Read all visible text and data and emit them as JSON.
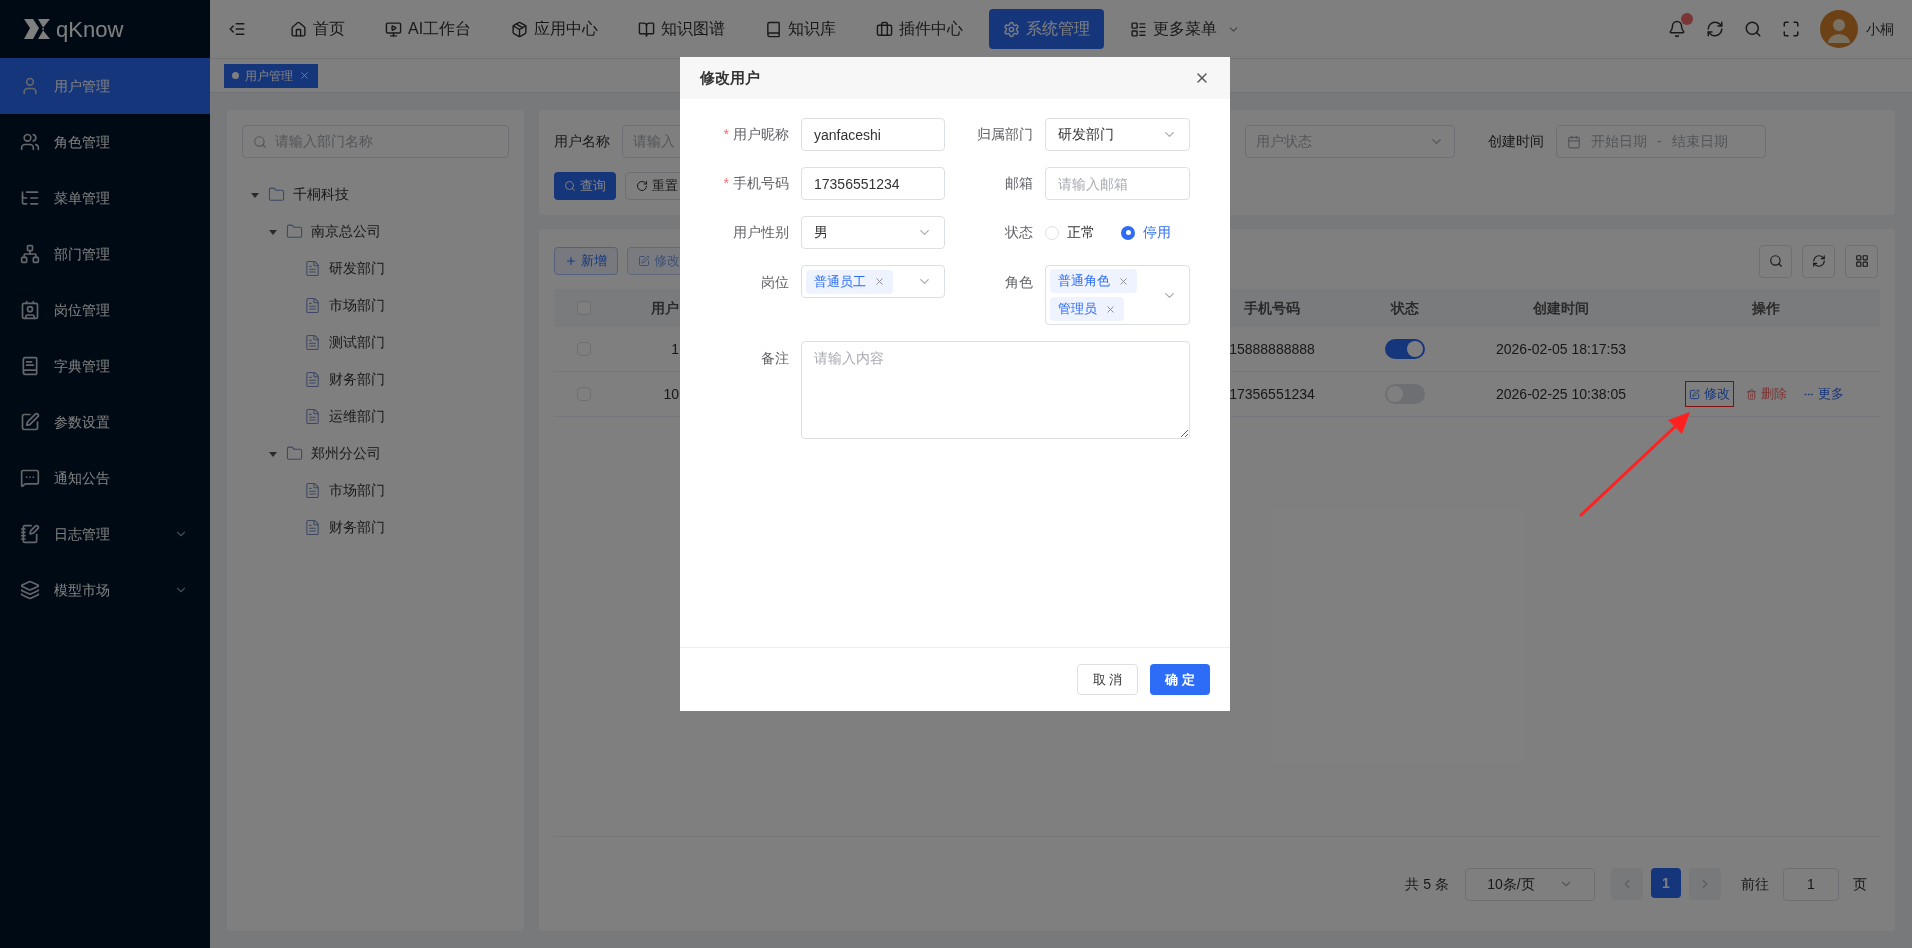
{
  "sidebar": {
    "logo": "qKnow",
    "items": [
      {
        "label": "用户管理",
        "selected": true,
        "submenu": false
      },
      {
        "label": "角色管理",
        "selected": false,
        "submenu": false
      },
      {
        "label": "菜单管理",
        "selected": false,
        "submenu": false
      },
      {
        "label": "部门管理",
        "selected": false,
        "submenu": false
      },
      {
        "label": "岗位管理",
        "selected": false,
        "submenu": false
      },
      {
        "label": "字典管理",
        "selected": false,
        "submenu": false
      },
      {
        "label": "参数设置",
        "selected": false,
        "submenu": false
      },
      {
        "label": "通知公告",
        "selected": false,
        "submenu": false
      },
      {
        "label": "日志管理",
        "selected": false,
        "submenu": true
      },
      {
        "label": "模型市场",
        "selected": false,
        "submenu": true
      }
    ]
  },
  "topnav": {
    "items": [
      {
        "label": "首页",
        "selected": false,
        "dropdown": false
      },
      {
        "label": "AI工作台",
        "selected": false,
        "dropdown": false
      },
      {
        "label": "应用中心",
        "selected": false,
        "dropdown": false
      },
      {
        "label": "知识图谱",
        "selected": false,
        "dropdown": false
      },
      {
        "label": "知识库",
        "selected": false,
        "dropdown": false
      },
      {
        "label": "插件中心",
        "selected": false,
        "dropdown": false
      },
      {
        "label": "系统管理",
        "selected": true,
        "dropdown": false
      },
      {
        "label": "更多菜单",
        "selected": false,
        "dropdown": true
      }
    ],
    "user": "小桐"
  },
  "tabs": [
    {
      "label": "用户管理",
      "selected": true
    }
  ],
  "dept_tree": {
    "search_placeholder": "请输入部门名称",
    "nodes": [
      {
        "label": "千桐科技",
        "expanded": true,
        "children": [
          {
            "label": "南京总公司",
            "expanded": true,
            "children": [
              {
                "label": "研发部门"
              },
              {
                "label": "市场部门"
              },
              {
                "label": "测试部门"
              },
              {
                "label": "财务部门"
              },
              {
                "label": "运维部门"
              }
            ]
          },
          {
            "label": "郑州分公司",
            "expanded": true,
            "children": [
              {
                "label": "市场部门"
              },
              {
                "label": "财务部门"
              }
            ]
          }
        ]
      }
    ]
  },
  "filters": {
    "user_name_label": "用户名称",
    "user_name_placeholder": "请输入",
    "status_placeholder": "用户状态",
    "created_label": "创建时间",
    "start_placeholder": "开始日期",
    "separator": "-",
    "end_placeholder": "结束日期",
    "search_button": "查询",
    "reset_button": "重置"
  },
  "toolbar": {
    "add_button": "新增",
    "edit_button": {
      "label": "修改",
      "disabled": true
    }
  },
  "table": {
    "columns": [
      "用户",
      "手机号码",
      "状态",
      "创建时间",
      "操作"
    ],
    "all_checked": false,
    "rows": [
      {
        "checked": false,
        "column_2": "1",
        "phone": "15888888888",
        "status_on": true,
        "created": "2026-02-05 18:17:53",
        "actions": []
      },
      {
        "checked": false,
        "column_2": "10",
        "phone": "17356551234",
        "status_on": false,
        "created": "2026-02-25 10:38:05",
        "actions": [
          {
            "label": "修改",
            "kind": "edit",
            "highlighted": true
          },
          {
            "label": "删除",
            "kind": "delete",
            "highlighted": false
          },
          {
            "label": "更多",
            "kind": "more",
            "highlighted": false
          }
        ]
      }
    ]
  },
  "pagination": {
    "total": "共 5 条",
    "page_size": "10条/页",
    "pages": [
      {
        "label": "1",
        "selected": true
      }
    ],
    "goto_label": "前往",
    "goto_value": "1",
    "page_suffix": "页"
  },
  "modal": {
    "title": "修改用户",
    "fields": [
      {
        "kind": "text",
        "label": "用户昵称",
        "required": true,
        "value": "yanfaceshi"
      },
      {
        "kind": "select",
        "label": "归属部门",
        "required": false,
        "value": "研发部门"
      },
      {
        "kind": "text",
        "label": "手机号码",
        "required": true,
        "value": "17356551234"
      },
      {
        "kind": "text",
        "label": "邮箱",
        "required": false,
        "placeholder": "请输入邮箱"
      },
      {
        "kind": "select",
        "label": "用户性别",
        "required": false,
        "value": "男"
      },
      {
        "kind": "radio",
        "label": "状态",
        "required": false,
        "options": [
          {
            "label": "正常",
            "selected": false
          },
          {
            "label": "停用",
            "selected": true
          }
        ]
      },
      {
        "kind": "tags",
        "label": "岗位",
        "required": false,
        "tags": [
          "普通员工"
        ]
      },
      {
        "kind": "tags",
        "label": "角色",
        "required": false,
        "tags": [
          "普通角色",
          "管理员"
        ]
      },
      {
        "kind": "textarea",
        "label": "备注",
        "required": false,
        "placeholder": "请输入内容"
      }
    ],
    "required_mark": "*",
    "cancel": "取 消",
    "confirm": "确 定"
  }
}
